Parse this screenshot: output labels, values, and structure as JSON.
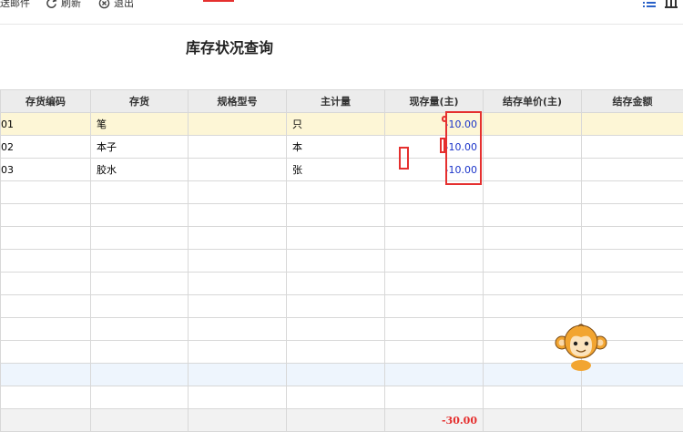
{
  "toolbar": {
    "email_label": "送邮件",
    "refresh_label": "刷新",
    "exit_label": "退出"
  },
  "page_title": "库存状况查询",
  "table": {
    "headers": [
      "存货编码",
      "存货",
      "规格型号",
      "主计量",
      "现存量(主)",
      "结存单价(主)",
      "结存金额"
    ],
    "rows": [
      {
        "code": "01",
        "name": "笔",
        "spec": "",
        "unit": "只",
        "qty": "-10.00",
        "price": "",
        "amount": ""
      },
      {
        "code": "02",
        "name": "本子",
        "spec": "",
        "unit": "本",
        "qty": "-10.00",
        "price": "",
        "amount": ""
      },
      {
        "code": "03",
        "name": "胶水",
        "spec": "",
        "unit": "张",
        "qty": "-10.00",
        "price": "",
        "amount": ""
      }
    ],
    "total_qty": "-30.00"
  },
  "colors": {
    "accent": "#e5302f",
    "qty_text": "#1a33c9",
    "selected_row": "#fdf6d6",
    "header_bg": "#ececec"
  }
}
